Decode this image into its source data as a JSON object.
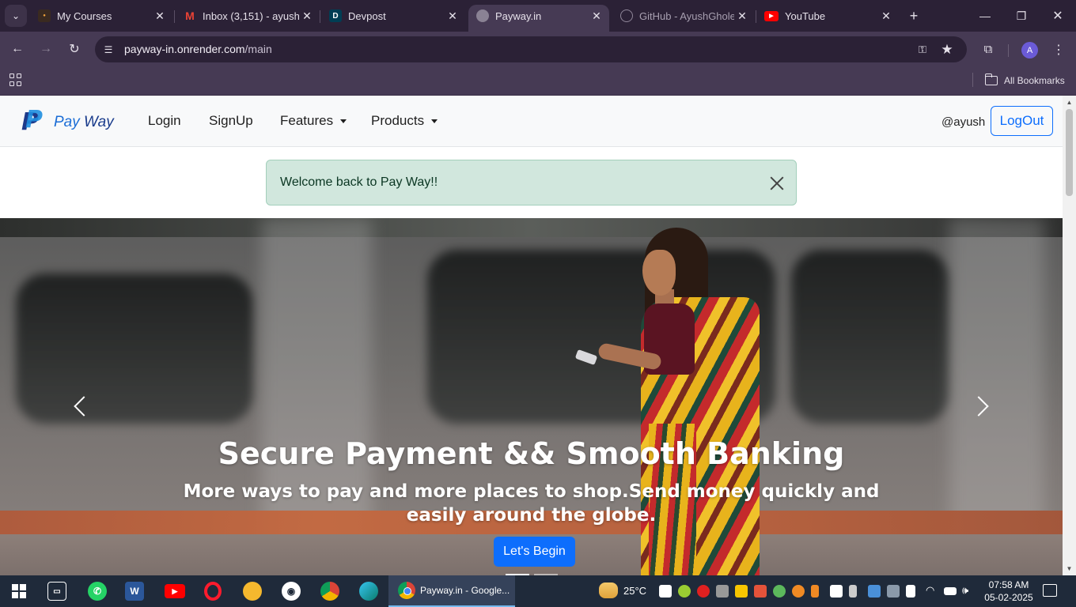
{
  "browser": {
    "tabs": [
      {
        "title": "My Courses",
        "favicon": "courses-favicon",
        "active": false
      },
      {
        "title": "Inbox (3,151) - ayush",
        "favicon": "gmail-icon",
        "active": false
      },
      {
        "title": "Devpost",
        "favicon": "devpost-icon",
        "favicon_text": "D",
        "active": false
      },
      {
        "title": "Payway.in",
        "favicon": "globe-icon",
        "active": true
      },
      {
        "title": "GitHub - AyushGhole",
        "favicon": "github-icon",
        "active": false
      },
      {
        "title": "YouTube",
        "favicon": "youtube-icon",
        "active": false
      }
    ],
    "url_host": "payway-in.onrender.com",
    "url_path": "/main",
    "profile_initial": "A",
    "bookmarks_label": "All Bookmarks"
  },
  "site": {
    "brand_part1": "Pay",
    "brand_part2": "Way",
    "nav": {
      "login": "Login",
      "signup": "SignUp",
      "features": "Features",
      "products": "Products"
    },
    "username": "@ayush",
    "logout": "LogOut",
    "alert": "Welcome back to Pay Way!!",
    "carousel": {
      "title": "Secure Payment && Smooth Banking",
      "subtitle": "More ways to pay and more places to shop.Send money quickly and easily around the globe.",
      "cta": "Let's Begin",
      "slide_count": 2,
      "active_slide": 1
    }
  },
  "taskbar": {
    "active_app": "Payway.in - Google...",
    "temperature": "25°C",
    "time": "07:58 AM",
    "date": "05-02-2025"
  },
  "colors": {
    "primary": "#0d6efd",
    "alert_bg": "#d1e7dd",
    "chrome_frame": "#2b2136",
    "chrome_toolbar": "#463a54",
    "taskbar": "#1f2a3a"
  }
}
